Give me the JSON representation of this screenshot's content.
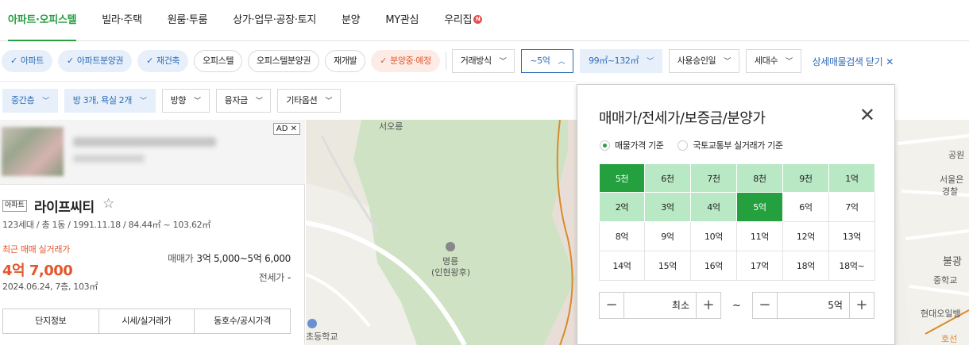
{
  "nav": {
    "tabs": [
      "아파트·오피스텔",
      "빌라·주택",
      "원룸·투룸",
      "상가·업무·공장·토지",
      "분양",
      "MY관심",
      "우리집"
    ],
    "new_badge": "N"
  },
  "filters": {
    "property_types": [
      {
        "label": "아파트",
        "selected": true
      },
      {
        "label": "아파트분양권",
        "selected": true
      },
      {
        "label": "재건축",
        "selected": true
      },
      {
        "label": "오피스텔",
        "selected": false
      },
      {
        "label": "오피스텔분양권",
        "selected": false
      },
      {
        "label": "재개발",
        "selected": false
      },
      {
        "label": "분양중·예정",
        "selected": true,
        "accent": "#e2572d"
      }
    ],
    "check_mark": "✓",
    "dropdowns": [
      "거래방식",
      "~5억",
      "99㎡~132㎡",
      "사용승인일",
      "세대수"
    ],
    "close_detail": "상세매물검색 닫기",
    "row2": [
      "중간층",
      "방 3개, 욕실 2개",
      "방향",
      "융자금",
      "기타옵션"
    ]
  },
  "listing": {
    "ad": "AD",
    "ad_close": "✕",
    "type_tag": "아파트",
    "name": "라이프씨티",
    "star": "☆",
    "info": "123세대 / 총 1동 / 1991.11.18 / 84.44㎡ ~ 103.62㎡",
    "recent_label": "최근 매매 실거래가",
    "recent_price": "4억 7,000",
    "recent_date": "2024.06.24, 7층, 103㎡",
    "sale_label": "매매가",
    "sale_value": "3억 5,000~5억 6,000",
    "jeonse_label": "전세가",
    "jeonse_value": "-",
    "buttons": [
      "단지정보",
      "시세/실거래가",
      "동호수/공시가격"
    ]
  },
  "map": {
    "labels": {
      "seooreung": "서오릉",
      "tomb1": "명릉",
      "tomb2": "(인현왕후)",
      "school": "초등학교",
      "park": "공원",
      "seoul1": "서울은",
      "seoul2": "경찰",
      "bulgwang": "불광",
      "school2": "중학교",
      "apt": "현대오일뱅",
      "hoseon": "호선"
    }
  },
  "price_popup": {
    "title": "매매가/전세가/보증금/분양가",
    "close": "✕",
    "radio_listing": "매물가격 기준",
    "radio_molit": "국토교통부 실거래가 기준",
    "options": [
      "5천",
      "6천",
      "7천",
      "8천",
      "9천",
      "1억",
      "2억",
      "3억",
      "4억",
      "5억",
      "6억",
      "7억",
      "8억",
      "9억",
      "10억",
      "11억",
      "12억",
      "13억",
      "14억",
      "15억",
      "16억",
      "17억",
      "18억",
      "18억~"
    ],
    "range_start_index": 0,
    "range_end_index": 9,
    "min_label": "최소",
    "max_value": "5억",
    "tilde": "~",
    "minus": "−",
    "plus": "+"
  },
  "colors": {
    "brand_green": "#2a9d45",
    "accent_blue": "#2d6bb8",
    "accent_orange": "#e2572d",
    "range_fill": "#b9e8c4"
  }
}
